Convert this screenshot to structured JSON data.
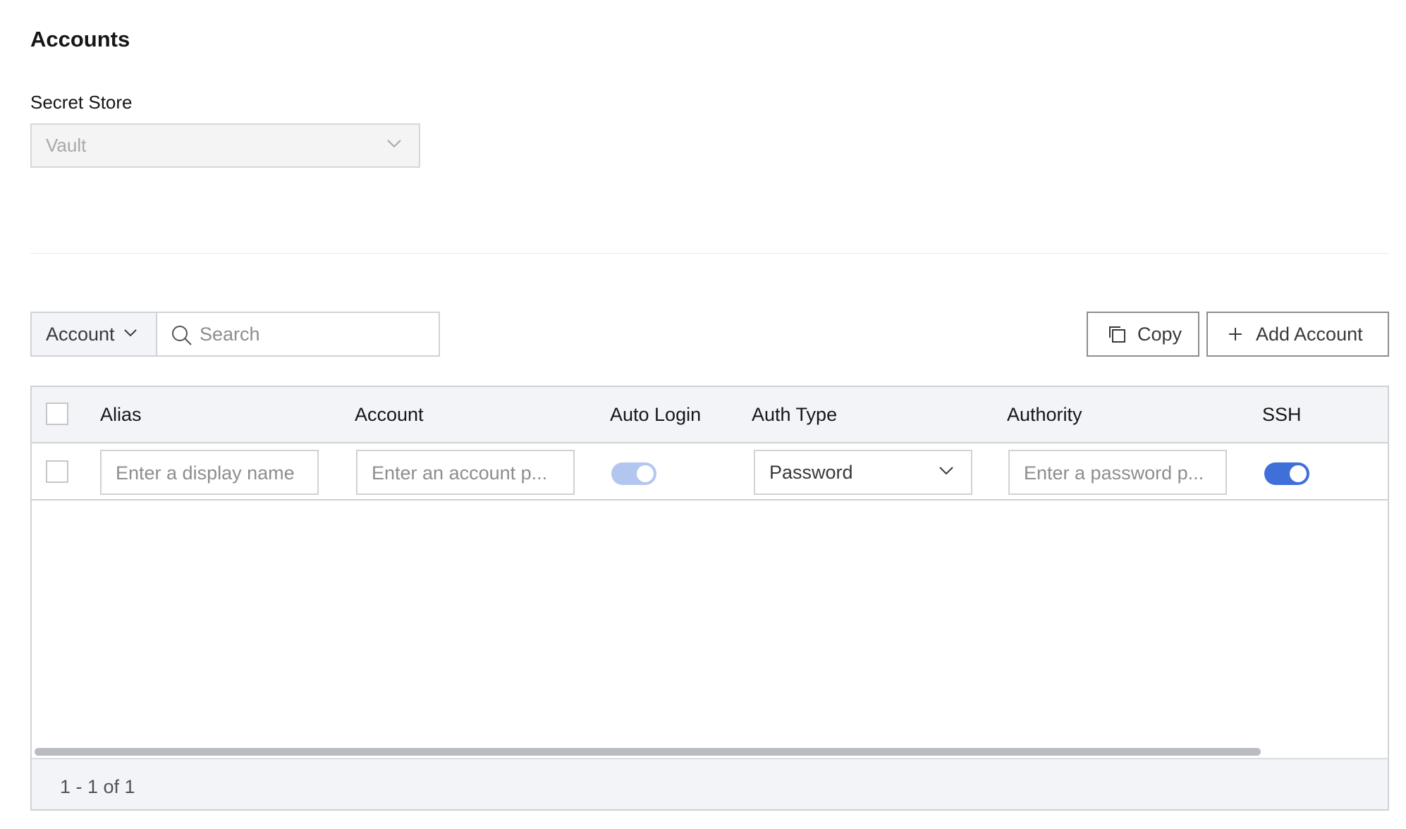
{
  "page": {
    "title": "Accounts"
  },
  "secret_store": {
    "label": "Secret Store",
    "selected": "Vault"
  },
  "toolbar": {
    "filter_selected": "Account",
    "search_placeholder": "Search",
    "copy_label": "Copy",
    "add_label": "Add Account"
  },
  "table": {
    "columns": [
      "Alias",
      "Account",
      "Auto Login",
      "Auth Type",
      "Authority",
      "SSH"
    ],
    "rows": [
      {
        "alias_placeholder": "Enter a display name",
        "account_placeholder": "Enter an account p...",
        "auto_login": true,
        "auth_type": "Password",
        "authority_placeholder": "Enter a password p...",
        "ssh": true
      }
    ],
    "pagination": "1 - 1 of 1"
  },
  "colors": {
    "toggle_on": "#3f6fd8",
    "toggle_disabled": "#b3c6f0",
    "header_bg": "#f2f4f8"
  }
}
